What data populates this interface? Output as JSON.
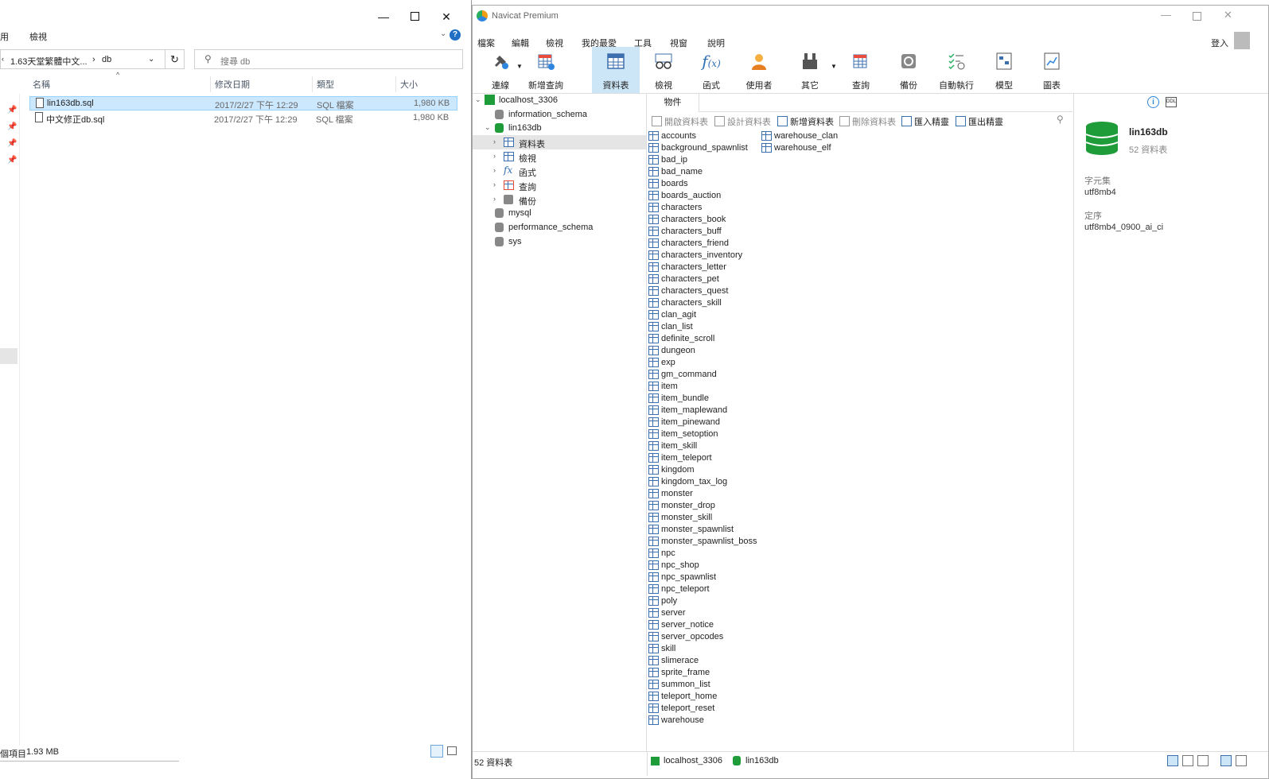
{
  "explorer": {
    "menu": [
      "用",
      "檢視"
    ],
    "breadcrumb": [
      "1.63天堂繁體中文...",
      "db"
    ],
    "search_placeholder": "搜尋 db",
    "columns": {
      "name": "名稱",
      "date": "修改日期",
      "type": "類型",
      "size": "大小"
    },
    "files": [
      {
        "name": "lin163db.sql",
        "date": "2017/2/27 下午 12:29",
        "type": "SQL 檔案",
        "size": "1,980 KB"
      },
      {
        "name": "中文修正db.sql",
        "date": "2017/2/27 下午 12:29",
        "type": "SQL 檔案",
        "size": "1,980 KB"
      }
    ],
    "status_left": "個項目",
    "status_size": "1.93 MB"
  },
  "navicat": {
    "title": "Navicat Premium",
    "menu": [
      "檔案",
      "編輯",
      "檢視",
      "我的最愛",
      "工具",
      "視窗",
      "說明"
    ],
    "login": "登入",
    "toolbar": [
      "連線",
      "新增查詢",
      "資料表",
      "檢視",
      "函式",
      "使用者",
      "其它",
      "查詢",
      "備份",
      "自動執行",
      "模型",
      "圖表"
    ],
    "tree": {
      "connection": "localhost_3306",
      "databases": [
        "information_schema",
        "lin163db",
        "mysql",
        "performance_schema",
        "sys"
      ],
      "children": [
        "資料表",
        "檢視",
        "函式",
        "查詢",
        "備份"
      ]
    },
    "object_tab": "物件",
    "object_toolbar": [
      "開啟資料表",
      "設計資料表",
      "新增資料表",
      "刪除資料表",
      "匯入精靈",
      "匯出精靈"
    ],
    "tables_col1": [
      "accounts",
      "background_spawnlist",
      "bad_ip",
      "bad_name",
      "boards",
      "boards_auction",
      "characters",
      "characters_book",
      "characters_buff",
      "characters_friend",
      "characters_inventory",
      "characters_letter",
      "characters_pet",
      "characters_quest",
      "characters_skill",
      "clan_agit",
      "clan_list",
      "definite_scroll",
      "dungeon",
      "exp",
      "gm_command",
      "item",
      "item_bundle",
      "item_maplewand",
      "item_pinewand",
      "item_setoption",
      "item_skill",
      "item_teleport",
      "kingdom",
      "kingdom_tax_log",
      "monster",
      "monster_drop",
      "monster_skill",
      "monster_spawnlist",
      "monster_spawnlist_boss",
      "npc",
      "npc_shop",
      "npc_spawnlist",
      "npc_teleport",
      "poly",
      "server",
      "server_notice",
      "server_opcodes",
      "skill",
      "slimerace",
      "sprite_frame",
      "summon_list",
      "teleport_home",
      "teleport_reset",
      "warehouse"
    ],
    "tables_col2": [
      "warehouse_clan",
      "warehouse_elf"
    ],
    "info": {
      "db_name": "lin163db",
      "count": "52 資料表",
      "charset_label": "字元集",
      "charset": "utf8mb4",
      "collation_label": "定序",
      "collation": "utf8mb4_0900_ai_ci"
    },
    "status": {
      "count": "52 資料表",
      "connection": "localhost_3306",
      "db": "lin163db"
    },
    "colors": {
      "db_green": "#1e9c3a",
      "table_blue": "#3c6fae",
      "selection": "#cce8ff",
      "toolbar_active": "#cde6f7"
    }
  }
}
